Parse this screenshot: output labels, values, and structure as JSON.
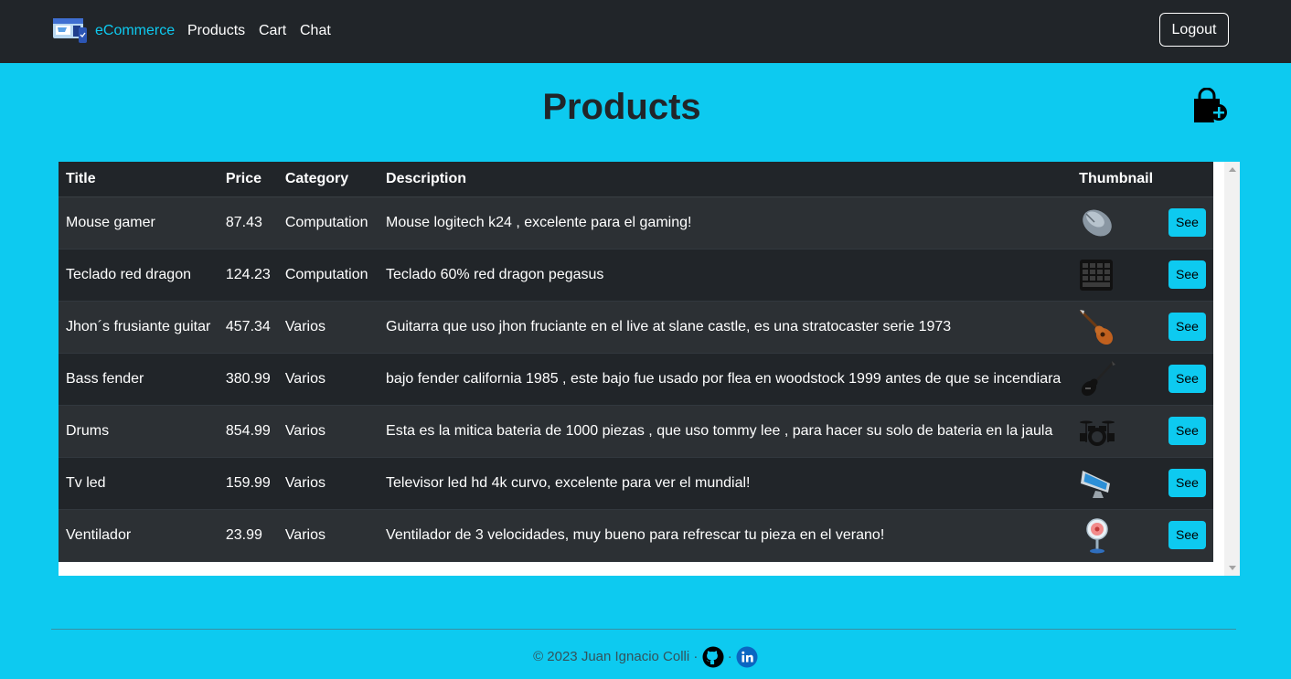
{
  "nav": {
    "brand": "eCommerce",
    "links": [
      "Products",
      "Cart",
      "Chat"
    ],
    "logout": "Logout"
  },
  "page": {
    "title": "Products",
    "add_icon": "bag-plus-icon"
  },
  "table": {
    "columns": [
      "Title",
      "Price",
      "Category",
      "Description",
      "Thumbnail"
    ],
    "rows": [
      {
        "title": "Mouse gamer",
        "price": "87.43",
        "category": "Computation",
        "description": "Mouse logitech k24 , excelente para el gaming!",
        "thumb": "mouse-icon",
        "action": "See"
      },
      {
        "title": "Teclado red dragon",
        "price": "124.23",
        "category": "Computation",
        "description": "Teclado 60% red dragon pegasus",
        "thumb": "keyboard-icon",
        "action": "See"
      },
      {
        "title": "Jhon´s frusiante guitar",
        "price": "457.34",
        "category": "Varios",
        "description": "Guitarra que uso jhon fruciante en el live at slane castle, es una stratocaster serie 1973",
        "thumb": "guitar-icon",
        "action": "See"
      },
      {
        "title": "Bass fender",
        "price": "380.99",
        "category": "Varios",
        "description": "bajo fender california 1985 , este bajo fue usado por flea en woodstock 1999 antes de que se incendiara",
        "thumb": "bass-icon",
        "action": "See"
      },
      {
        "title": "Drums",
        "price": "854.99",
        "category": "Varios",
        "description": "Esta es la mitica bateria de 1000 piezas , que uso tommy lee , para hacer su solo de bateria en la jaula",
        "thumb": "drums-icon",
        "action": "See"
      },
      {
        "title": "Tv led",
        "price": "159.99",
        "category": "Varios",
        "description": "Televisor led hd 4k curvo, excelente para ver el mundial!",
        "thumb": "tv-icon",
        "action": "See"
      },
      {
        "title": "Ventilador",
        "price": "23.99",
        "category": "Varios",
        "description": "Ventilador de 3 velocidades, muy bueno para refrescar tu pieza en el verano!",
        "thumb": "fan-icon",
        "action": "See"
      }
    ]
  },
  "footer": {
    "text": "© 2023 Juan Ignacio Colli",
    "sep": "·",
    "icons": [
      "github-icon",
      "linkedin-icon"
    ]
  }
}
